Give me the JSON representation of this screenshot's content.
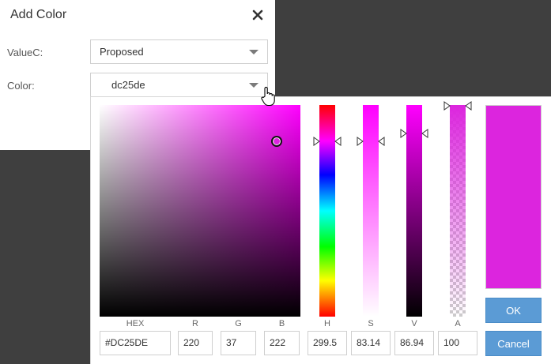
{
  "dialog": {
    "title": "Add Color",
    "close_icon": "close-icon",
    "fields": [
      {
        "label": "ValueC:",
        "value": "Proposed"
      },
      {
        "label": "Color:",
        "value": "dc25de"
      }
    ]
  },
  "picker": {
    "current_color": "#dc25de",
    "hue_color": "#ff00ff",
    "inputs": [
      {
        "label": "HEX",
        "value": "#DC25DE"
      },
      {
        "label": "R",
        "value": "220"
      },
      {
        "label": "G",
        "value": "37"
      },
      {
        "label": "B",
        "value": "222"
      },
      {
        "label": "H",
        "value": "299.5"
      },
      {
        "label": "S",
        "value": "83.14"
      },
      {
        "label": "V",
        "value": "86.94"
      },
      {
        "label": "A",
        "value": "100"
      }
    ],
    "ok_label": "OK",
    "cancel_label": "Cancel"
  }
}
